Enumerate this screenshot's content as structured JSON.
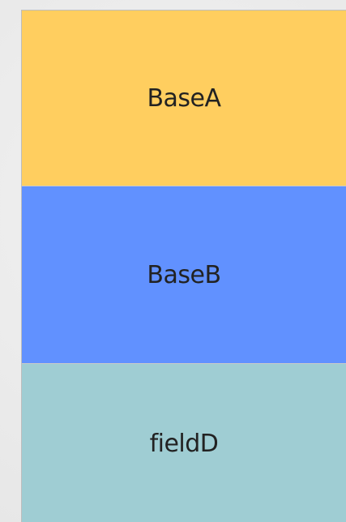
{
  "blocks": [
    {
      "label": "BaseA",
      "color": "#ffce5f"
    },
    {
      "label": "BaseB",
      "color": "#6191ff"
    },
    {
      "label": "fieldD",
      "color": "#9fcdd3"
    }
  ]
}
